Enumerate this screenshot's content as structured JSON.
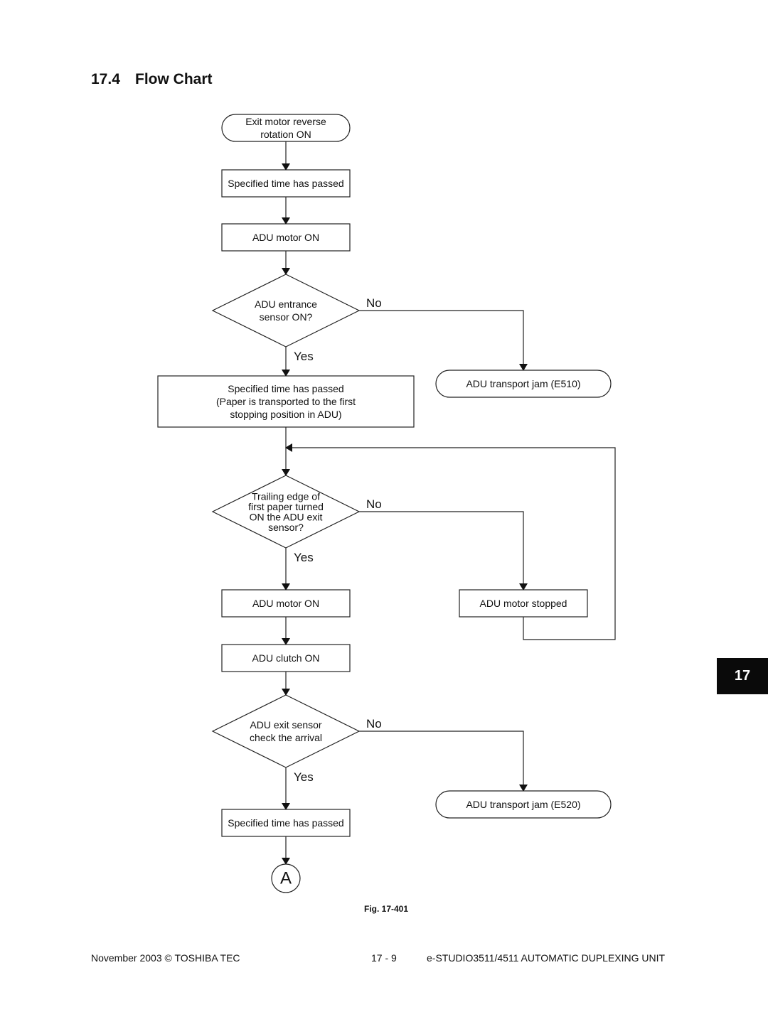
{
  "section": {
    "number": "17.4",
    "title": "Flow Chart"
  },
  "flowchart": {
    "nodes": [
      {
        "id": "start",
        "type": "terminal",
        "lines": [
          "Exit motor reverse",
          "rotation ON"
        ]
      },
      {
        "id": "wait1",
        "type": "process",
        "lines": [
          "Specified time has passed"
        ]
      },
      {
        "id": "motor_on_1",
        "type": "process",
        "lines": [
          "ADU motor ON"
        ]
      },
      {
        "id": "entrance_check",
        "type": "decision",
        "lines": [
          "ADU entrance",
          "sensor ON?"
        ]
      },
      {
        "id": "jam_e510",
        "type": "terminal",
        "lines": [
          "ADU transport jam (E510)"
        ]
      },
      {
        "id": "wait2",
        "type": "process",
        "lines": [
          "Specified time has passed",
          "(Paper is transported to the first",
          "stopping position in ADU)"
        ]
      },
      {
        "id": "trailing_check",
        "type": "decision",
        "lines": [
          "Trailing edge of",
          "first paper turned",
          "ON the ADU exit",
          "sensor?"
        ]
      },
      {
        "id": "motor_stopped",
        "type": "process",
        "lines": [
          "ADU motor stopped"
        ]
      },
      {
        "id": "motor_on_2",
        "type": "process",
        "lines": [
          "ADU motor ON"
        ]
      },
      {
        "id": "clutch_on",
        "type": "process",
        "lines": [
          "ADU clutch ON"
        ]
      },
      {
        "id": "exit_check",
        "type": "decision",
        "lines": [
          "ADU exit sensor",
          "check the arrival"
        ]
      },
      {
        "id": "jam_e520",
        "type": "terminal",
        "lines": [
          "ADU transport jam (E520)"
        ]
      },
      {
        "id": "wait3",
        "type": "process",
        "lines": [
          "Specified time has passed"
        ]
      },
      {
        "id": "connector_a",
        "type": "connector",
        "lines": [
          "A"
        ]
      }
    ],
    "edges": [
      {
        "from": "start",
        "to": "wait1",
        "label": ""
      },
      {
        "from": "wait1",
        "to": "motor_on_1",
        "label": ""
      },
      {
        "from": "motor_on_1",
        "to": "entrance_check",
        "label": ""
      },
      {
        "from": "entrance_check",
        "to": "jam_e510",
        "label": "No"
      },
      {
        "from": "entrance_check",
        "to": "wait2",
        "label": "Yes"
      },
      {
        "from": "wait2",
        "to": "trailing_check",
        "label": ""
      },
      {
        "from": "trailing_check",
        "to": "motor_stopped",
        "label": "No"
      },
      {
        "from": "motor_stopped",
        "to": "trailing_check",
        "label": ""
      },
      {
        "from": "trailing_check",
        "to": "motor_on_2",
        "label": "Yes"
      },
      {
        "from": "motor_on_2",
        "to": "clutch_on",
        "label": ""
      },
      {
        "from": "clutch_on",
        "to": "exit_check",
        "label": ""
      },
      {
        "from": "exit_check",
        "to": "jam_e520",
        "label": "No"
      },
      {
        "from": "exit_check",
        "to": "wait3",
        "label": "Yes"
      },
      {
        "from": "wait3",
        "to": "connector_a",
        "label": ""
      }
    ]
  },
  "figure": {
    "caption": "Fig. 17-401"
  },
  "footer": {
    "left": "November 2003 © TOSHIBA TEC",
    "page": "17 - 9",
    "right": "e-STUDIO3511/4511  AUTOMATIC DUPLEXING UNIT"
  },
  "chapter_tab": {
    "label": "17"
  }
}
